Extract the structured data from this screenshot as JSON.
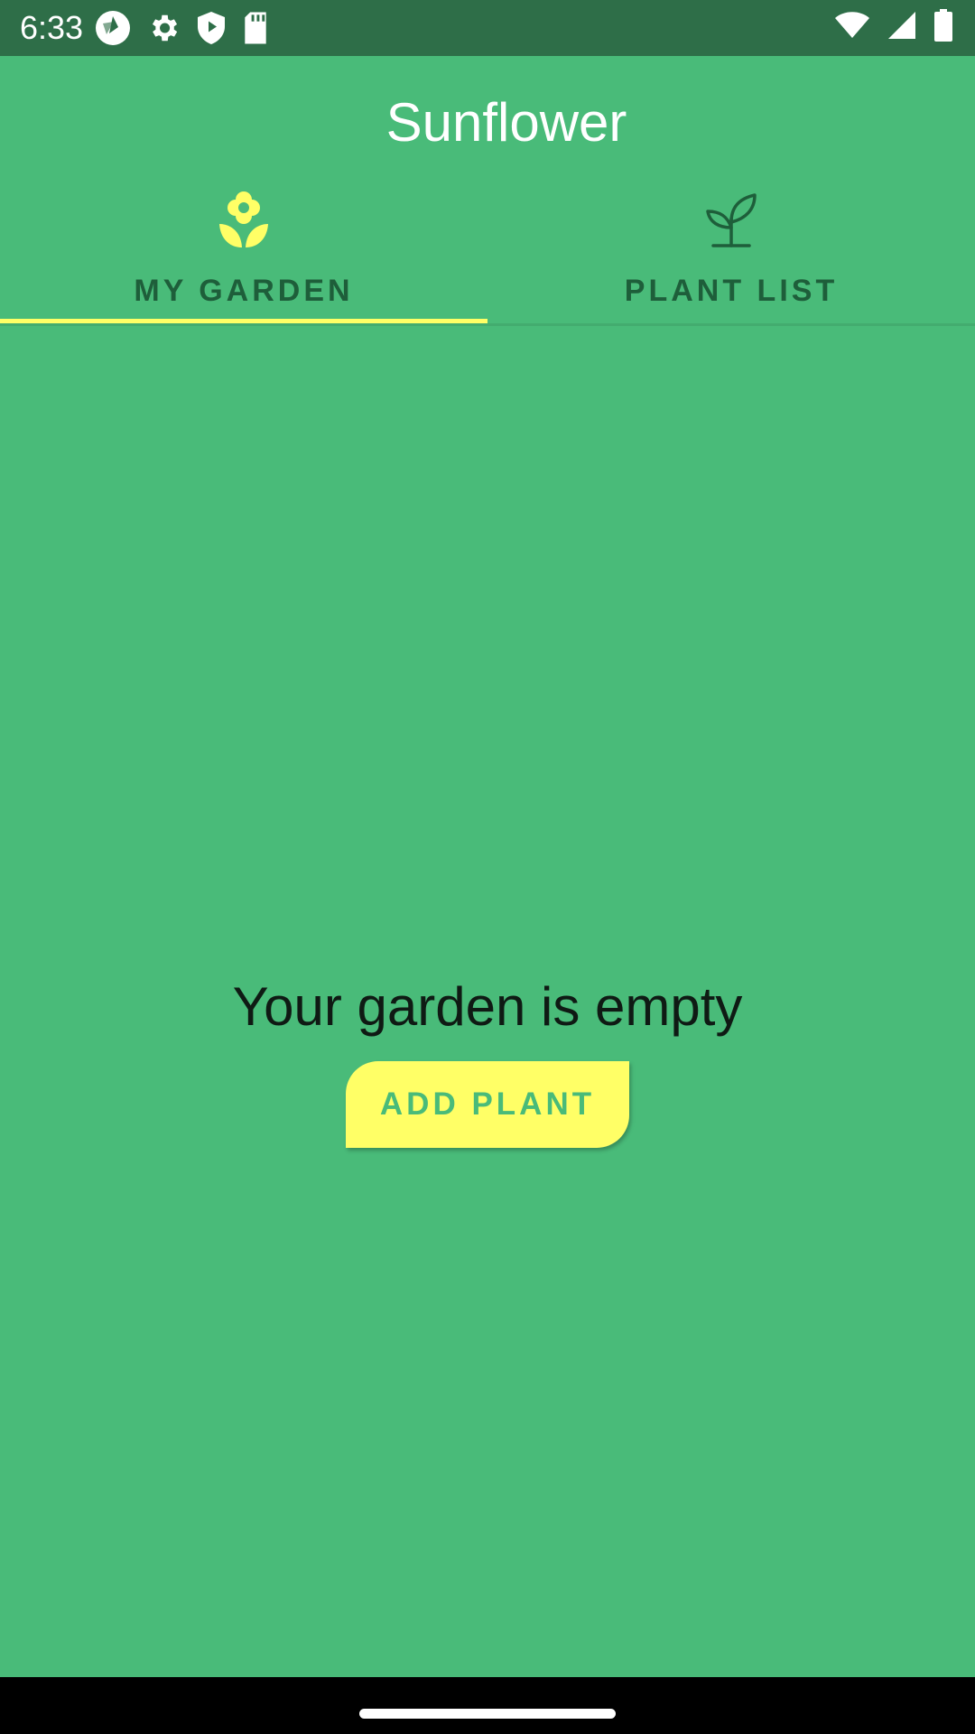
{
  "status_bar": {
    "time": "6:33",
    "left_icons": [
      "camera-shutter-icon",
      "gear-icon",
      "shield-icon",
      "sd-card-icon"
    ],
    "right_icons": [
      "wifi-icon",
      "signal-icon",
      "battery-icon"
    ],
    "background": "#2E6E48"
  },
  "app_bar": {
    "title": "Sunflower",
    "background": "#49BB79"
  },
  "tabs": [
    {
      "label": "MY GARDEN",
      "icon": "flower-icon",
      "selected": true
    },
    {
      "label": "PLANT LIST",
      "icon": "sprout-icon",
      "selected": false
    }
  ],
  "content": {
    "empty_message": "Your garden is empty",
    "add_button_label": "ADD PLANT"
  },
  "colors": {
    "primary": "#49BB79",
    "accent": "#FFFF66",
    "tab_text": "#1E5E3A"
  }
}
